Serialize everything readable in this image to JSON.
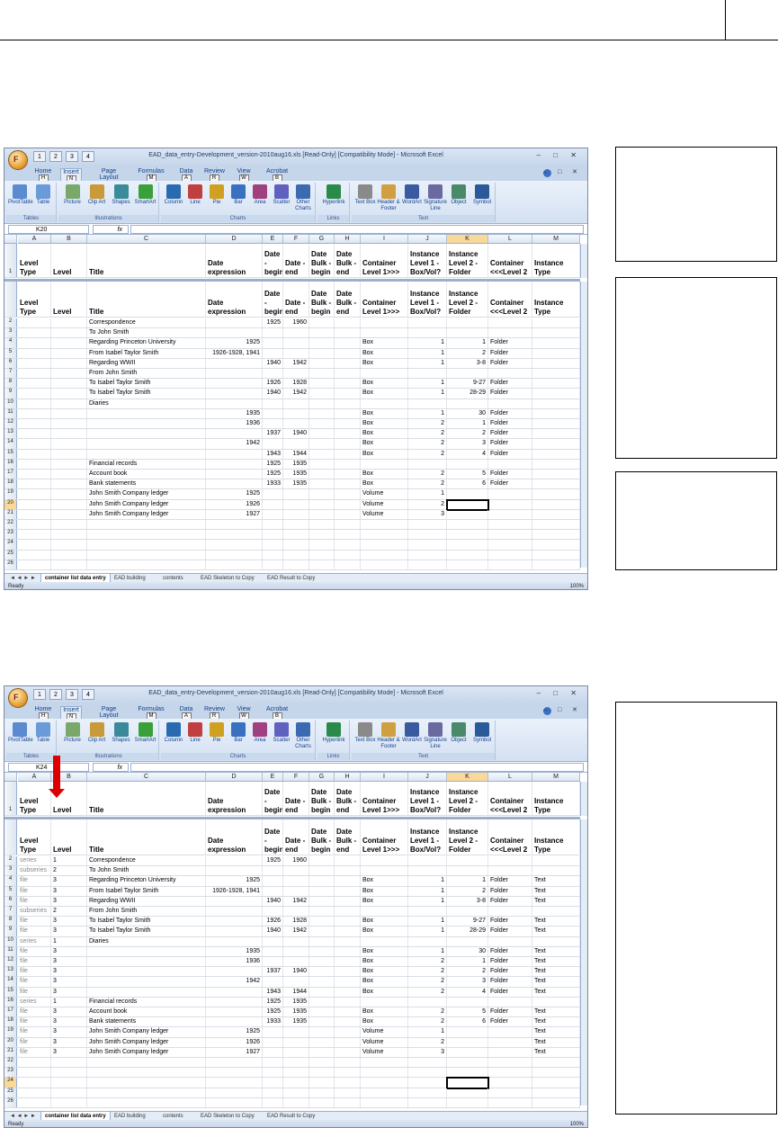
{
  "windows": [
    {
      "id": "top",
      "title": "EAD_data_entry-Development_version-2010aug16.xls  [Read-Only]  [Compatibility Mode] - Microsoft Excel",
      "name_box": "K20",
      "fx": "fx",
      "active_row": "20",
      "show_level_data": false
    },
    {
      "id": "bottom",
      "title": "EAD_data_entry-Development_version-2010aug16.xls  [Read-Only]  [Compatibility Mode] - Microsoft Excel",
      "name_box": "K24",
      "fx": "fx",
      "active_row": "24",
      "show_level_data": true
    }
  ],
  "tabs": [
    {
      "label": "Home",
      "key": "H"
    },
    {
      "label": "Insert",
      "key": "N"
    },
    {
      "label": "Page Layout",
      "key": "P"
    },
    {
      "label": "Formulas",
      "key": "M"
    },
    {
      "label": "Data",
      "key": "A"
    },
    {
      "label": "Review",
      "key": "R"
    },
    {
      "label": "View",
      "key": "W"
    },
    {
      "label": "Acrobat",
      "key": "B"
    }
  ],
  "qat_keys": [
    "1",
    "2",
    "3",
    "4"
  ],
  "office_key": "F",
  "ribbon": {
    "tables_label": "Tables",
    "illustrations_label": "Illustrations",
    "charts_label": "Charts",
    "links_label": "Links",
    "text_label": "Text",
    "buttons": [
      "PivotTable",
      "Table",
      "Picture",
      "Clip Art",
      "Shapes",
      "SmartArt",
      "Column",
      "Line",
      "Pie",
      "Bar",
      "Area",
      "Scatter",
      "Other Charts",
      "Hyperlink",
      "Text Box",
      "Header & Footer",
      "WordArt",
      "Signature Line",
      "Object",
      "Symbol"
    ]
  },
  "columns": [
    "A",
    "B",
    "C",
    "D",
    "E",
    "F",
    "G",
    "H",
    "I",
    "J",
    "K",
    "L",
    "M"
  ],
  "headers": [
    "Level Type",
    "Level",
    "Title",
    "Date expression",
    "Date - begin",
    "Date - end",
    "Date Bulk - begin",
    "Date Bulk - end",
    "Container Level 1>>>",
    "Instance Level 1 - Box/Vol?",
    "Instance Level 2 - Folder",
    "Container <<<Level 2",
    "Instance Type"
  ],
  "rows": [
    {
      "n": "2",
      "a": "series",
      "b": "1",
      "c": "Correspondence",
      "d": "",
      "e": "1925",
      "f": "1960",
      "i": "",
      "j": "",
      "k": "",
      "l": "",
      "m": ""
    },
    {
      "n": "3",
      "a": "subseries",
      "b": "2",
      "c": "To John Smith",
      "d": "",
      "e": "",
      "f": "",
      "i": "",
      "j": "",
      "k": "",
      "l": "",
      "m": ""
    },
    {
      "n": "4",
      "a": "file",
      "b": "3",
      "c": "Regarding Princeton University",
      "d": "1925",
      "e": "",
      "f": "",
      "i": "Box",
      "j": "1",
      "k": "1",
      "l": "Folder",
      "m": "Text"
    },
    {
      "n": "5",
      "a": "file",
      "b": "3",
      "c": "From Isabel Taylor Smith",
      "d": "1926-1928, 1941",
      "e": "",
      "f": "",
      "i": "Box",
      "j": "1",
      "k": "2",
      "l": "Folder",
      "m": "Text"
    },
    {
      "n": "6",
      "a": "file",
      "b": "3",
      "c": "Regarding WWII",
      "d": "",
      "e": "1940",
      "f": "1942",
      "i": "Box",
      "j": "1",
      "k": "3-8",
      "l": "Folder",
      "m": "Text"
    },
    {
      "n": "7",
      "a": "subseries",
      "b": "2",
      "c": "From John Smith",
      "d": "",
      "e": "",
      "f": "",
      "i": "",
      "j": "",
      "k": "",
      "l": "",
      "m": ""
    },
    {
      "n": "8",
      "a": "file",
      "b": "3",
      "c": "To Isabel Taylor Smith",
      "d": "",
      "e": "1926",
      "f": "1928",
      "i": "Box",
      "j": "1",
      "k": "9-27",
      "l": "Folder",
      "m": "Text"
    },
    {
      "n": "9",
      "a": "file",
      "b": "3",
      "c": "To Isabel Taylor Smith",
      "d": "",
      "e": "1940",
      "f": "1942",
      "i": "Box",
      "j": "1",
      "k": "28-29",
      "l": "Folder",
      "m": "Text"
    },
    {
      "n": "10",
      "a": "series",
      "b": "1",
      "c": "Diaries",
      "d": "",
      "e": "",
      "f": "",
      "i": "",
      "j": "",
      "k": "",
      "l": "",
      "m": ""
    },
    {
      "n": "11",
      "a": "file",
      "b": "3",
      "c": "",
      "d": "1935",
      "e": "",
      "f": "",
      "i": "Box",
      "j": "1",
      "k": "30",
      "l": "Folder",
      "m": "Text"
    },
    {
      "n": "12",
      "a": "file",
      "b": "3",
      "c": "",
      "d": "1936",
      "e": "",
      "f": "",
      "i": "Box",
      "j": "2",
      "k": "1",
      "l": "Folder",
      "m": "Text"
    },
    {
      "n": "13",
      "a": "file",
      "b": "3",
      "c": "",
      "d": "",
      "e": "1937",
      "f": "1940",
      "i": "Box",
      "j": "2",
      "k": "2",
      "l": "Folder",
      "m": "Text"
    },
    {
      "n": "14",
      "a": "file",
      "b": "3",
      "c": "",
      "d": "1942",
      "e": "",
      "f": "",
      "i": "Box",
      "j": "2",
      "k": "3",
      "l": "Folder",
      "m": "Text"
    },
    {
      "n": "15",
      "a": "file",
      "b": "3",
      "c": "",
      "d": "",
      "e": "1943",
      "f": "1944",
      "i": "Box",
      "j": "2",
      "k": "4",
      "l": "Folder",
      "m": "Text"
    },
    {
      "n": "16",
      "a": "series",
      "b": "1",
      "c": "Financial records",
      "d": "",
      "e": "1925",
      "f": "1935",
      "i": "",
      "j": "",
      "k": "",
      "l": "",
      "m": ""
    },
    {
      "n": "17",
      "a": "file",
      "b": "3",
      "c": "Account book",
      "d": "",
      "e": "1925",
      "f": "1935",
      "i": "Box",
      "j": "2",
      "k": "5",
      "l": "Folder",
      "m": "Text"
    },
    {
      "n": "18",
      "a": "file",
      "b": "3",
      "c": "Bank statements",
      "d": "",
      "e": "1933",
      "f": "1935",
      "i": "Box",
      "j": "2",
      "k": "6",
      "l": "Folder",
      "m": "Text"
    },
    {
      "n": "19",
      "a": "file",
      "b": "3",
      "c": "John Smith Company ledger",
      "d": "1925",
      "e": "",
      "f": "",
      "i": "Volume",
      "j": "1",
      "k": "",
      "l": "",
      "m": "Text"
    },
    {
      "n": "20",
      "a": "file",
      "b": "3",
      "c": "John Smith Company ledger",
      "d": "1926",
      "e": "",
      "f": "",
      "i": "Volume",
      "j": "2",
      "k": "",
      "l": "",
      "m": "Text"
    },
    {
      "n": "21",
      "a": "file",
      "b": "3",
      "c": "John Smith Company ledger",
      "d": "1927",
      "e": "",
      "f": "",
      "i": "Volume",
      "j": "3",
      "k": "",
      "l": "",
      "m": "Text"
    },
    {
      "n": "22"
    },
    {
      "n": "23"
    },
    {
      "n": "24"
    },
    {
      "n": "25"
    },
    {
      "n": "26"
    }
  ],
  "sheet_tabs": [
    "container list data entry",
    "EAD building",
    "contents",
    "EAD Skeleton to Copy",
    "EAD Result to Copy"
  ],
  "status": "Ready",
  "zoom": "100%"
}
